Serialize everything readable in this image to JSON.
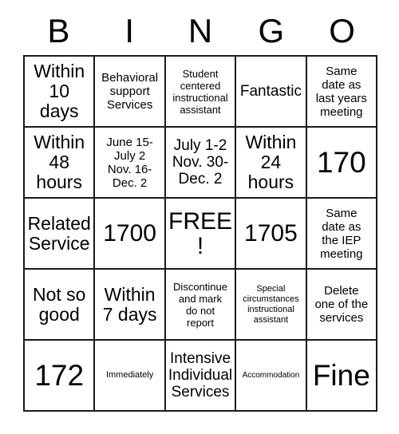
{
  "card": {
    "header_letters": [
      "B",
      "I",
      "N",
      "G",
      "O"
    ],
    "rows": [
      [
        {
          "text": "Within\n10\ndays",
          "size": "lg"
        },
        {
          "text": "Behavioral\nsupport\nServices",
          "size": "sm"
        },
        {
          "text": "Student\ncentered\ninstructional\nassistant",
          "size": "xs"
        },
        {
          "text": "Fantastic",
          "size": "md"
        },
        {
          "text": "Same\ndate as\nlast years\nmeeting",
          "size": "sm"
        }
      ],
      [
        {
          "text": "Within\n48\nhours",
          "size": "lg"
        },
        {
          "text": "June 15-\nJuly 2\nNov. 16-\nDec. 2",
          "size": "sm"
        },
        {
          "text": "July 1-2\nNov. 30-\nDec. 2",
          "size": "md"
        },
        {
          "text": "Within\n24\nhours",
          "size": "lg"
        },
        {
          "text": "170",
          "size": "xxl"
        }
      ],
      [
        {
          "text": "Related\nService",
          "size": "lg"
        },
        {
          "text": "1700",
          "size": "xl"
        },
        {
          "text": "FREE!",
          "size": "xl"
        },
        {
          "text": "1705",
          "size": "xl"
        },
        {
          "text": "Same\ndate as\nthe IEP\nmeeting",
          "size": "sm"
        }
      ],
      [
        {
          "text": "Not so\ngood",
          "size": "lg"
        },
        {
          "text": "Within\n7 days",
          "size": "lg"
        },
        {
          "text": "Discontinue\nand mark\ndo not\nreport",
          "size": "xs"
        },
        {
          "text": "Special\ncircumstances\ninstructional\nassistant",
          "size": "xxs"
        },
        {
          "text": "Delete\none of the\nservices",
          "size": "sm"
        }
      ],
      [
        {
          "text": "172",
          "size": "xxl"
        },
        {
          "text": "Immediately",
          "size": "xxs"
        },
        {
          "text": "Intensive\nIndividual\nServices",
          "size": "md"
        },
        {
          "text": "Accommodation",
          "size": "min"
        },
        {
          "text": "Fine",
          "size": "xxl"
        }
      ]
    ]
  }
}
